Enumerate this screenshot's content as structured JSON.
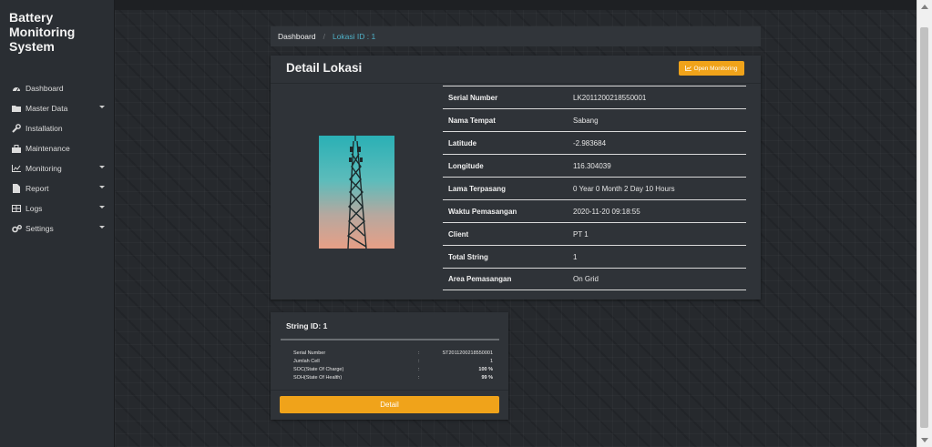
{
  "sidebar": {
    "brand": "Battery Monitoring System",
    "items": [
      {
        "label": "Dashboard",
        "icon": "dashboard-icon",
        "has_caret": false
      },
      {
        "label": "Master Data",
        "icon": "folder-icon",
        "has_caret": true
      },
      {
        "label": "Installation",
        "icon": "wrench-icon",
        "has_caret": false
      },
      {
        "label": "Maintenance",
        "icon": "toolbox-icon",
        "has_caret": false
      },
      {
        "label": "Monitoring",
        "icon": "chart-icon",
        "has_caret": true
      },
      {
        "label": "Report",
        "icon": "file-icon",
        "has_caret": true
      },
      {
        "label": "Logs",
        "icon": "table-icon",
        "has_caret": true
      },
      {
        "label": "Settings",
        "icon": "gears-icon",
        "has_caret": true
      }
    ]
  },
  "breadcrumb": {
    "home": "Dashboard",
    "current": "Lokasi ID : 1"
  },
  "detail": {
    "title": "Detail Lokasi",
    "monitor_button": "Open Monitoring",
    "rows": [
      {
        "key": "Serial Number",
        "value": "LK2011200218550001"
      },
      {
        "key": "Nama Tempat",
        "value": "Sabang"
      },
      {
        "key": "Latitude",
        "value": "-2.983684"
      },
      {
        "key": "Longitude",
        "value": "116.304039"
      },
      {
        "key": "Lama Terpasang",
        "value": "0 Year 0 Month 2 Day 10 Hours"
      },
      {
        "key": "Waktu Pemasangan",
        "value": "2020-11-20 09:18:55"
      },
      {
        "key": "Client",
        "value": "PT 1"
      },
      {
        "key": "Total String",
        "value": "1"
      },
      {
        "key": "Area Pemasangan",
        "value": "On Grid"
      }
    ]
  },
  "string_card": {
    "title": "String ID: 1",
    "rows": [
      {
        "key": "Serial Number",
        "sep": ":",
        "value": "ST2011200218550001"
      },
      {
        "key": "Jumlah Cell",
        "sep": ":",
        "value": "1"
      },
      {
        "key": "SOC(State Of Charge)",
        "sep": ":",
        "value": "100 %"
      },
      {
        "key": "SOH(State Of Health)",
        "sep": ":",
        "value": "99 %"
      }
    ],
    "button": "Detail"
  },
  "colors": {
    "accent": "#f0a31a",
    "link": "#4fb0c6",
    "panel": "#2f3338",
    "sidebar": "#2a2e33"
  }
}
